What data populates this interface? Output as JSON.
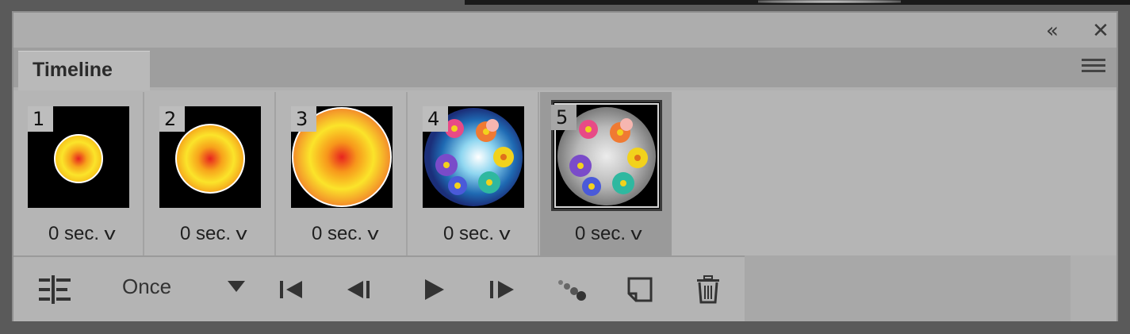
{
  "panel": {
    "tab_label": "Timeline",
    "collapse_glyph": "«",
    "close_glyph": "✕"
  },
  "frames": [
    {
      "number": "1",
      "delay": "0 sec.",
      "selected": false
    },
    {
      "number": "2",
      "delay": "0 sec.",
      "selected": false
    },
    {
      "number": "3",
      "delay": "0 sec.",
      "selected": false
    },
    {
      "number": "4",
      "delay": "0 sec.",
      "selected": false
    },
    {
      "number": "5",
      "delay": "0 sec.",
      "selected": true
    }
  ],
  "toolbar": {
    "loop_option": "Once",
    "icons": [
      "convert-to-video-timeline-icon",
      "first-frame-icon",
      "previous-frame-icon",
      "play-icon",
      "next-frame-icon",
      "tween-icon",
      "duplicate-frame-icon",
      "trash-icon"
    ]
  },
  "colors": {
    "panel_bg": "#b0b0b0",
    "tab_bg": "#b9b9b9",
    "selected_frame_bg": "#9a9a9a",
    "icon": "#333333"
  }
}
